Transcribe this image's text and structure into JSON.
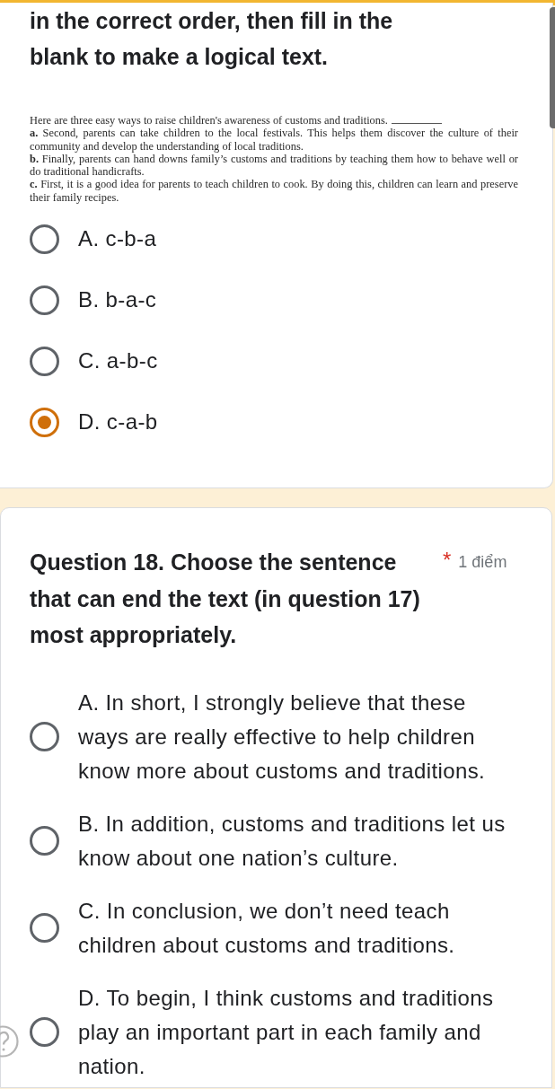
{
  "question_17": {
    "title": "in the correct order, then fill in the blank to make a logical text.",
    "passage": {
      "intro": "Here are three easy ways to raise children's awareness of customs and traditions.",
      "items": [
        "**a.** Second, parents can take children to the local festivals. This helps them discover the culture of their community and develop the understanding of local traditions.",
        "**b.** Finally, parents can hand downs family’s customs and traditions by teaching them how to behave well or do traditional handicrafts.",
        "**c.** First, it is a good idea for parents to teach children to cook. By doing this, children can learn and preserve their family recipes."
      ]
    },
    "options": [
      {
        "label": "A. c-b-a",
        "selected": false
      },
      {
        "label": "B. b-a-c",
        "selected": false
      },
      {
        "label": "C. a-b-c",
        "selected": false
      },
      {
        "label": "D. c-a-b",
        "selected": true
      }
    ]
  },
  "question_18": {
    "title": "Question 18. Choose the sentence that can end the text (in question 17) most appropriately.",
    "required_mark": "*",
    "points": "1 điểm",
    "options": [
      {
        "label": "A. In short, I strongly believe that these ways are really effective to help children know more about customs and traditions.",
        "selected": false
      },
      {
        "label": "B. In addition, customs and traditions let us know about one nation’s culture.",
        "selected": false
      },
      {
        "label": "C. In conclusion, we don’t need teach children about customs and traditions.",
        "selected": false
      },
      {
        "label": "D. To begin, I think customs and traditions play an important part in each family and nation.",
        "selected": false
      }
    ]
  }
}
